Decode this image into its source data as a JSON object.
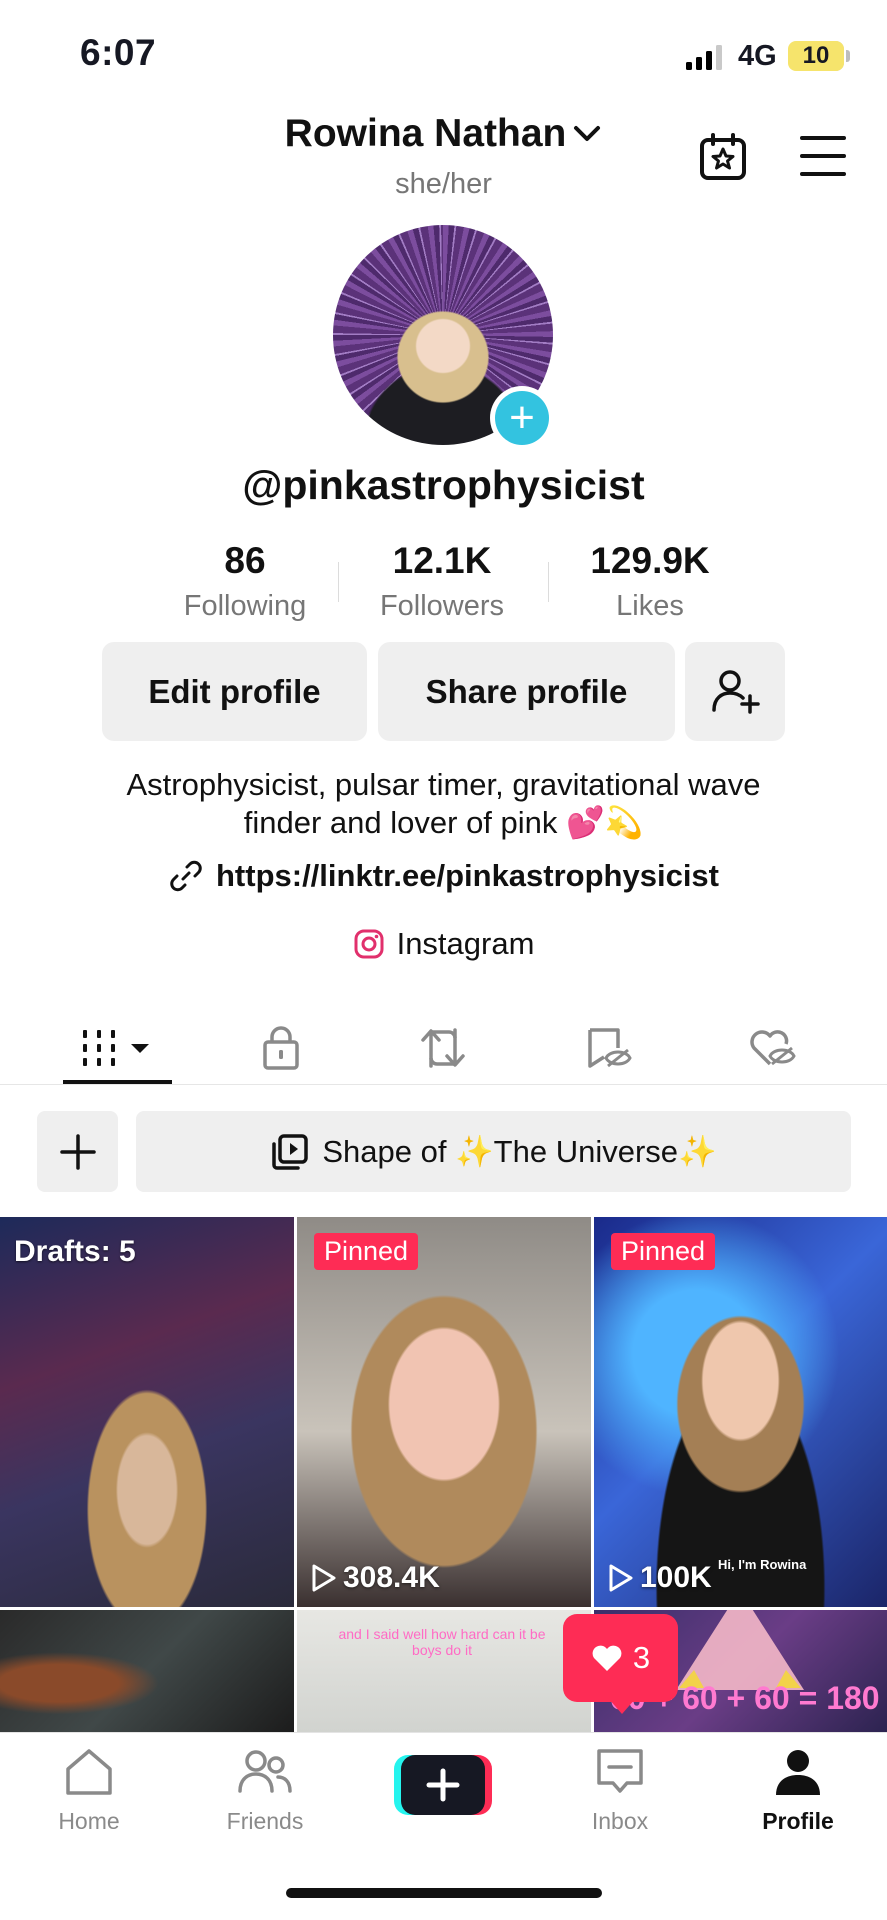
{
  "status_bar": {
    "time": "6:07",
    "network": "4G",
    "battery": "10"
  },
  "header": {
    "name": "Rowina Nathan",
    "pronouns": "she/her"
  },
  "profile": {
    "username": "@pinkastrophysicist",
    "stats": [
      {
        "value": "86",
        "label": "Following"
      },
      {
        "value": "12.1K",
        "label": "Followers"
      },
      {
        "value": "129.9K",
        "label": "Likes"
      }
    ],
    "edit_label": "Edit profile",
    "share_label": "Share profile",
    "bio_line1": "Astrophysicist, pulsar timer, gravitational wave",
    "bio_line2": "finder and lover of pink 💕💫",
    "link": "https://linktr.ee/pinkastrophysicist",
    "instagram": "Instagram"
  },
  "tabs": [
    "videos",
    "private",
    "reposts",
    "favorites",
    "liked"
  ],
  "playlist": {
    "name": "Shape of ✨The Universe✨"
  },
  "grid": [
    {
      "label": "Drafts: 5"
    },
    {
      "badge": "Pinned",
      "views": "308.4K"
    },
    {
      "badge": "Pinned",
      "views": "100K",
      "caption": "Hi, I'm Rowina"
    },
    {},
    {
      "caption": "and I said well how hard can it be boys do it"
    },
    {
      "caption": "60 + 60 + 60 = 180"
    }
  ],
  "notification": {
    "count": "3"
  },
  "nav": {
    "home": "Home",
    "friends": "Friends",
    "inbox": "Inbox",
    "profile": "Profile"
  },
  "colors": {
    "accent": "#fe2c55",
    "teal": "#33c3e0",
    "chip": "#efefef"
  }
}
